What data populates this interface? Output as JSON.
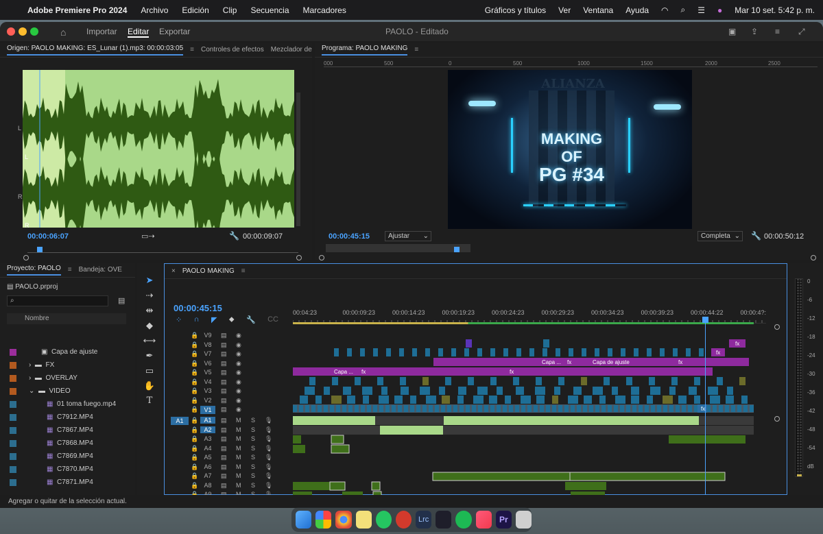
{
  "menubar": {
    "app": "Adobe Premiere Pro 2024",
    "items": [
      "Archivo",
      "Edición",
      "Clip",
      "Secuencia",
      "Marcadores"
    ],
    "right_items": [
      "Gráficos y títulos",
      "Ver",
      "Ventana",
      "Ayuda"
    ],
    "clock": "Mar 10 set.  5:42 p. m."
  },
  "window": {
    "title": "PAOLO - Editado",
    "nav": [
      "Importar",
      "Editar",
      "Exportar"
    ],
    "active_nav": "Editar"
  },
  "source": {
    "tabs": [
      "Origen: PAOLO MAKING: ES_Lunar (1).mp3: 00:00:03:05",
      "Controles de efectos",
      "Mezclador de"
    ],
    "tc_in": "00:00:06:07",
    "tc_dur": "00:00:09:07",
    "ch_labels": [
      "L",
      "L",
      "R",
      "R"
    ]
  },
  "program": {
    "tab": "Programa: PAOLO MAKING",
    "ruler": [
      "000",
      "500",
      "0",
      "500",
      "1000",
      "1500",
      "2000",
      "2500"
    ],
    "tc": "00:00:45:15",
    "fit": "Ajustar",
    "quality": "Completa",
    "tc_dur": "00:00:50:12",
    "image_text": [
      "MAKING OF",
      "PG #34"
    ],
    "image_bg_text": "ALIANZA"
  },
  "project": {
    "tabs": [
      "Proyecto: PAOLO",
      "Bandeja: OVE"
    ],
    "file": "PAOLO.prproj",
    "col": "Nombre",
    "items": [
      {
        "name": "Capa de ajuste",
        "color": "#9b2d9b",
        "kind": "item"
      },
      {
        "name": "FX",
        "color": "#b35a1f",
        "kind": "folder"
      },
      {
        "name": "OVERLAY",
        "color": "#b35a1f",
        "kind": "folder"
      },
      {
        "name": "VIDEO",
        "color": "#b35a1f",
        "kind": "folder"
      },
      {
        "name": "01 toma fuego.mp4",
        "color": "#2c6e8f",
        "kind": "clip"
      },
      {
        "name": "C7912.MP4",
        "color": "#2c6e8f",
        "kind": "clip"
      },
      {
        "name": "C7867.MP4",
        "color": "#2c6e8f",
        "kind": "clip"
      },
      {
        "name": "C7868.MP4",
        "color": "#2c6e8f",
        "kind": "clip"
      },
      {
        "name": "C7869.MP4",
        "color": "#2c6e8f",
        "kind": "clip"
      },
      {
        "name": "C7870.MP4",
        "color": "#2c6e8f",
        "kind": "clip"
      },
      {
        "name": "C7871.MP4",
        "color": "#2c6e8f",
        "kind": "clip"
      }
    ]
  },
  "timeline": {
    "tab": "PAOLO MAKING",
    "tc": "00:00:45:15",
    "ruler": [
      "00:04:23",
      "00:00:09:23",
      "00:00:14:23",
      "00:00:19:23",
      "00:00:24:23",
      "00:00:29:23",
      "00:00:34:23",
      "00:00:39:23",
      "00:00:44:22",
      "00:00:4?:22"
    ],
    "video_tracks": [
      "V9",
      "V8",
      "V7",
      "V6",
      "V5",
      "V4",
      "V3",
      "V2",
      "V1"
    ],
    "audio_tracks": [
      "A1",
      "A2",
      "A3",
      "A4",
      "A5",
      "A6",
      "A7",
      "A8",
      "A9"
    ],
    "src_patch_v": "V1",
    "src_patch_a": "A1",
    "labels": {
      "capa_a": "Capa ...",
      "capa_b": "Capa de ajuste",
      "fx": "fx"
    }
  },
  "meter": {
    "scale": [
      "0",
      "-6",
      "-12",
      "-18",
      "-24",
      "-30",
      "-36",
      "-42",
      "-48",
      "-54",
      "dB"
    ]
  },
  "status": "Agregar o quitar de la selección actual.",
  "colors": {
    "accent": "#4aa3ff",
    "video_clip": "#1e6e96",
    "adjust_clip": "#8e2a9e",
    "audio_wave": "#a9d889"
  }
}
